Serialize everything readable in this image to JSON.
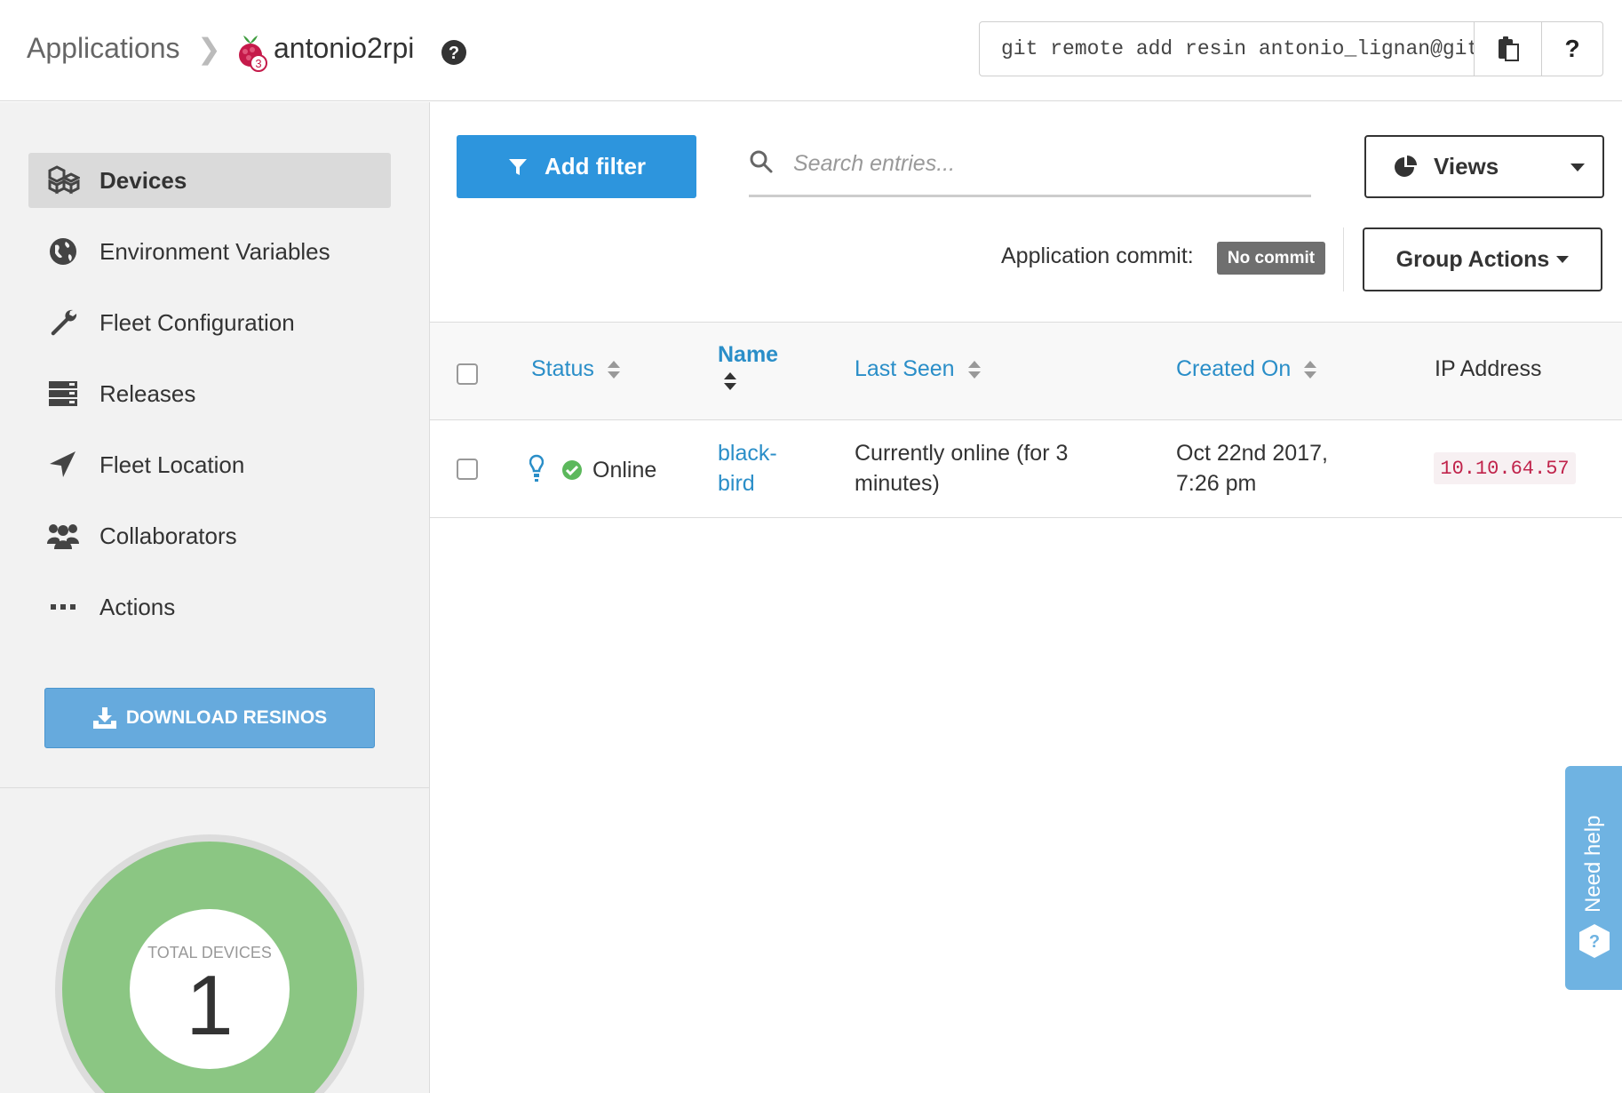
{
  "header": {
    "breadcrumb_root": "Applications",
    "app_name": "antonio2rpi",
    "rpi_badge": "3",
    "git_command": "git remote add resin antonio_lignan@git",
    "help_label": "?"
  },
  "sidebar": {
    "items": [
      {
        "label": "Devices",
        "icon": "cubes-icon",
        "active": true
      },
      {
        "label": "Environment Variables",
        "icon": "globe-icon"
      },
      {
        "label": "Fleet Configuration",
        "icon": "wrench-icon"
      },
      {
        "label": "Releases",
        "icon": "server-icon"
      },
      {
        "label": "Fleet Location",
        "icon": "location-arrow-icon"
      },
      {
        "label": "Collaborators",
        "icon": "users-icon"
      },
      {
        "label": "Actions",
        "icon": "ellipsis-icon"
      }
    ],
    "download_label": "DOWNLOAD RESINOS",
    "summary": {
      "label": "TOTAL DEVICES",
      "value": "1"
    }
  },
  "toolbar": {
    "add_filter_label": "Add filter",
    "search_placeholder": "Search entries...",
    "views_label": "Views",
    "commit_label": "Application commit:",
    "commit_value": "No commit",
    "group_actions_label": "Group Actions"
  },
  "table": {
    "columns": [
      "Status",
      "Name",
      "Last Seen",
      "Created On",
      "IP Address"
    ],
    "rows": [
      {
        "status": "Online",
        "name_line1": "black-",
        "name_line2": "bird",
        "last_seen_line1": "Currently online (for 3",
        "last_seen_line2": "minutes)",
        "created_line1": "Oct 22nd 2017,",
        "created_line2": "7:26 pm",
        "ip": "10.10.64.57"
      }
    ]
  },
  "help_tab": {
    "label": "Need help"
  },
  "colors": {
    "primary": "#2d95dd",
    "download": "#66aadd",
    "donut": "#8bc683",
    "online": "#5cb85c",
    "ip_text": "#c0234b"
  }
}
